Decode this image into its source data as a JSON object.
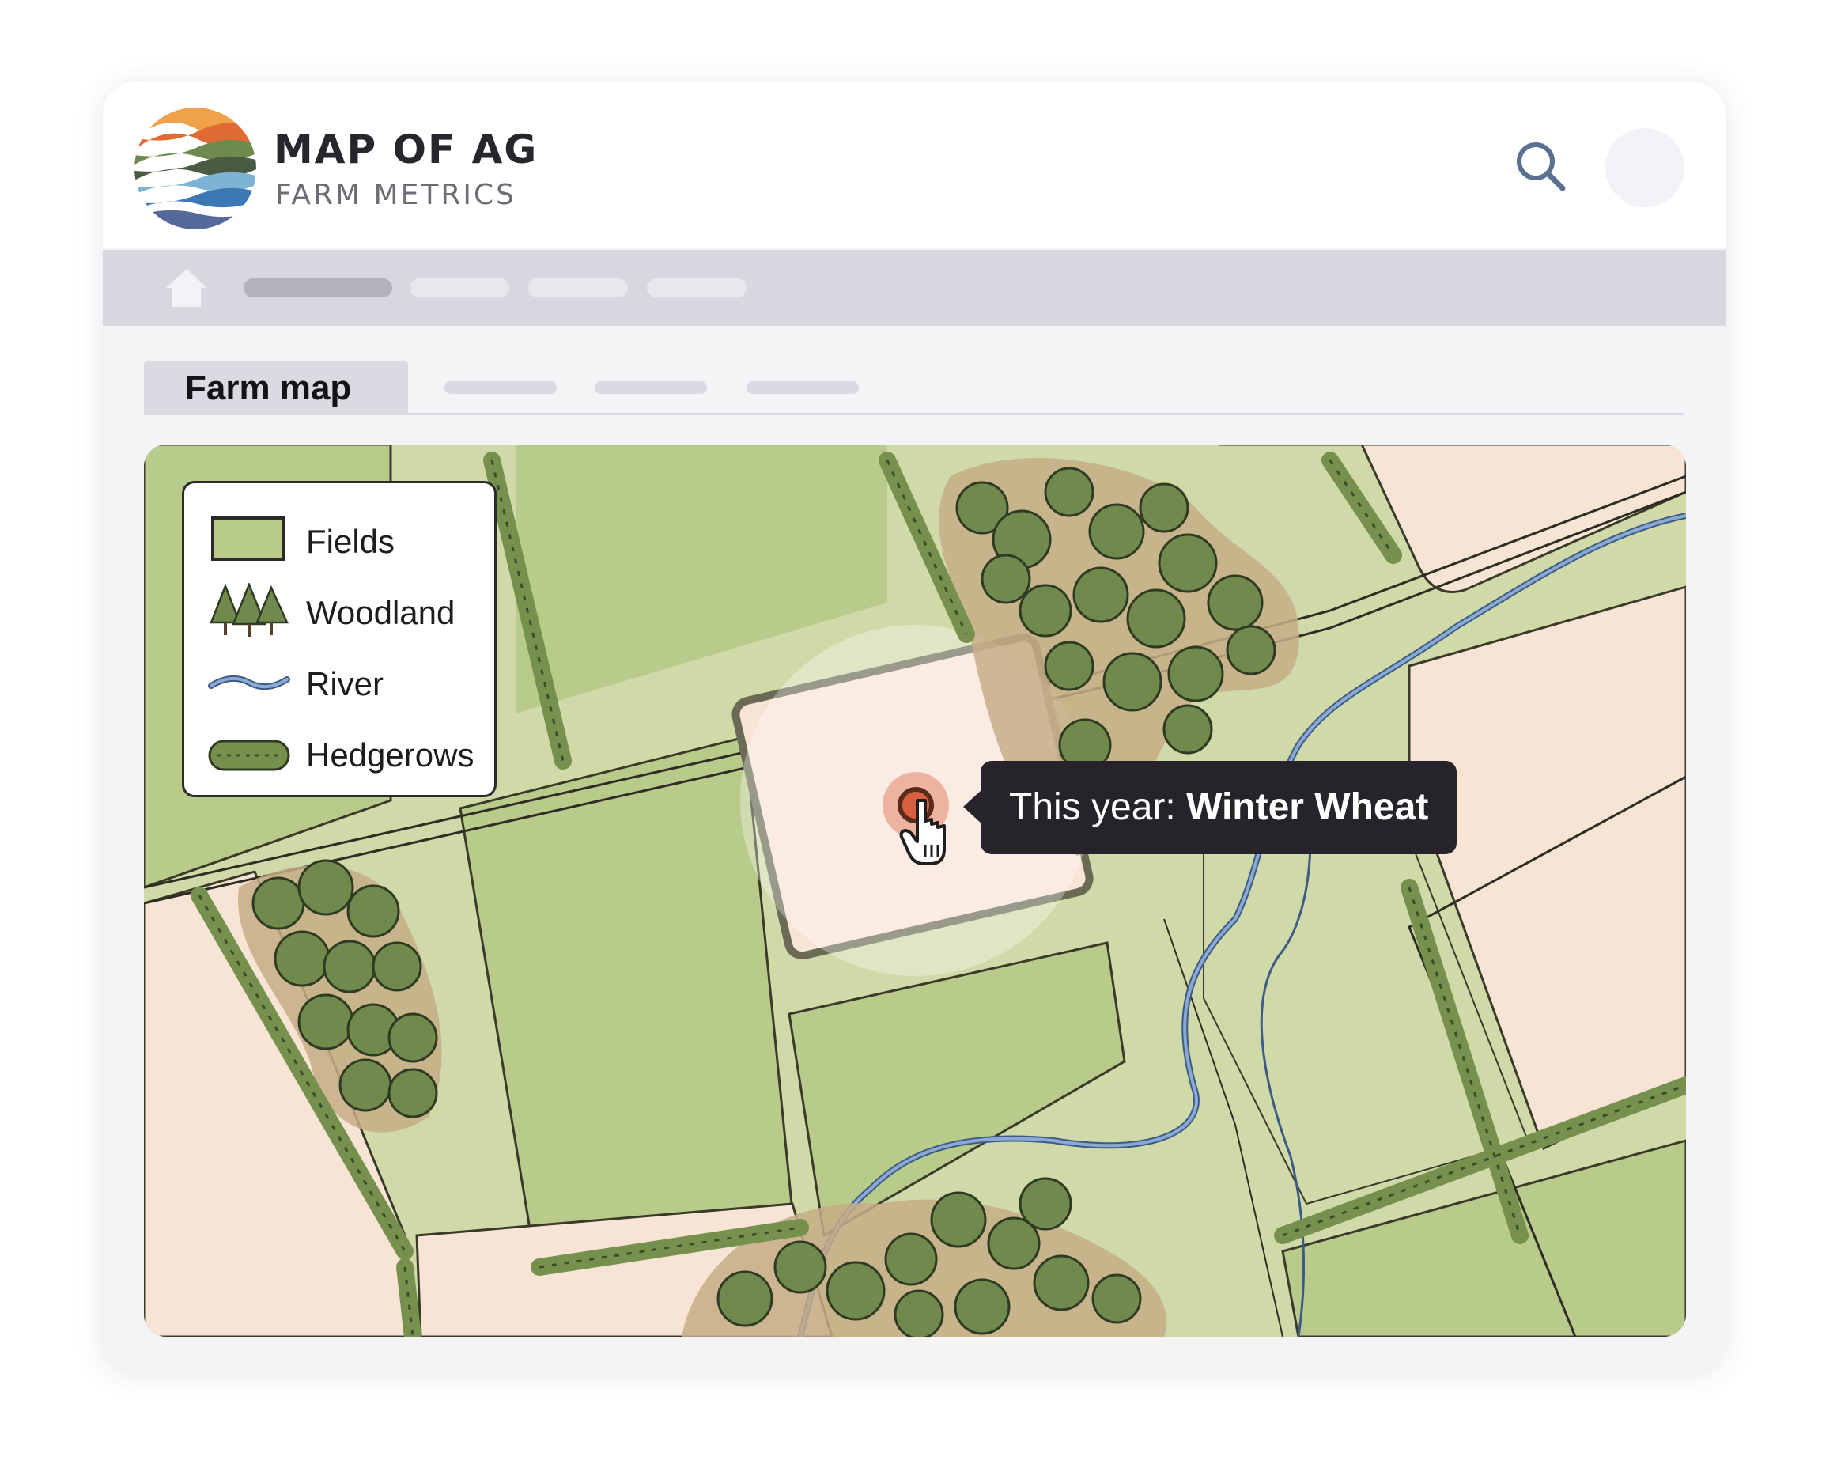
{
  "brand": {
    "title": "MAP OF AG",
    "subtitle": "FARM METRICS",
    "colors": [
      "#e5803a",
      "#5b7a4a",
      "#4a8fc2"
    ]
  },
  "header": {
    "search_icon": "search-icon"
  },
  "nav": {
    "home_icon": "home-icon"
  },
  "tabs": {
    "active_label": "Farm map"
  },
  "legend": {
    "items": [
      {
        "label": "Fields",
        "icon": "field-swatch-icon"
      },
      {
        "label": "Woodland",
        "icon": "trees-icon"
      },
      {
        "label": "River",
        "icon": "river-line-icon"
      },
      {
        "label": "Hedgerows",
        "icon": "hedge-icon"
      }
    ]
  },
  "tooltip": {
    "prefix": "This year: ",
    "crop": "Winter Wheat"
  },
  "colors": {
    "field_green": "#b8cb8b",
    "field_light": "#cfdaa8",
    "field_peach": "#f7e4d4",
    "woodland": "#6f8a4c",
    "river": "#7d9ccc",
    "hedgerow": "#76904e",
    "tooltip_bg": "#27232a",
    "pin": "#d9603f"
  }
}
